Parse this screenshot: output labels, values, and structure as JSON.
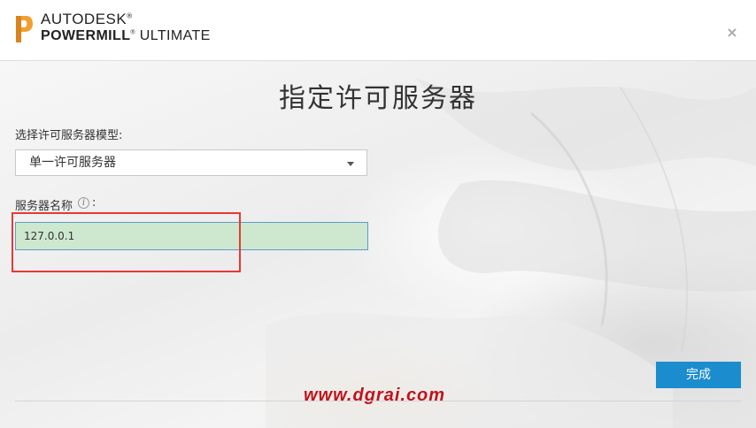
{
  "header": {
    "brand_line1": "AUTODESK",
    "brand_product_bold": "POWERMILL",
    "brand_edition": "ULTIMATE",
    "registered_mark": "®",
    "close_glyph": "×"
  },
  "page": {
    "title": "指定许可服务器"
  },
  "form": {
    "model_label": "选择许可服务器模型:",
    "model_selected": "单一许可服务器",
    "server_name_label": "服务器名称",
    "server_name_suffix": ":",
    "info_glyph": "i",
    "server_name_value": "127.0.0.1"
  },
  "footer": {
    "done_label": "完成",
    "watermark": "www.dgrai.com"
  },
  "icons": {
    "logo": "powermill-logo-icon",
    "close": "close-icon",
    "dropdown": "chevron-down-icon",
    "info": "info-icon"
  },
  "colors": {
    "accent": "#1b8ccd",
    "input_fill": "#cde8cf",
    "highlight_border": "#e53935",
    "watermark": "#c1121c",
    "logo_orange": "#f0a030"
  }
}
